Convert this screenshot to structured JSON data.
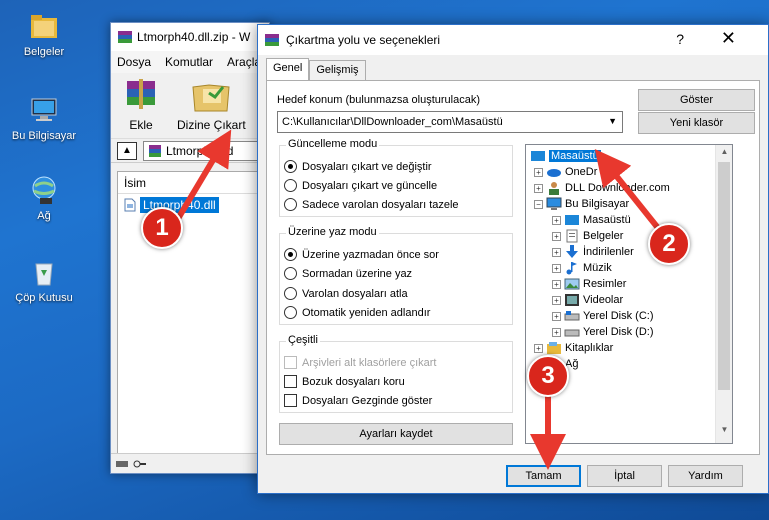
{
  "desktop": {
    "icons": [
      {
        "label": "Belgeler",
        "icon": "folder-icon"
      },
      {
        "label": "Bu Bilgisayar",
        "icon": "computer-icon"
      },
      {
        "label": "Ağ",
        "icon": "network-icon"
      },
      {
        "label": "Çöp Kutusu",
        "icon": "recycle-bin-icon"
      }
    ]
  },
  "winrar": {
    "title": "Ltmorph40.dll.zip - W",
    "menu": [
      "Dosya",
      "Komutlar",
      "Araçla"
    ],
    "toolbar": {
      "add": "Ekle",
      "extract": "Dizine Çıkart"
    },
    "path": "Ltmorph40.d",
    "column_name": "İsim",
    "file": "Ltmorph40.dll"
  },
  "dialog": {
    "title": "Çıkartma yolu ve seçenekleri",
    "help": "?",
    "close": "✕",
    "tabs": [
      "Genel",
      "Gelişmiş"
    ],
    "dest_label": "Hedef konum (bulunmazsa oluşturulacak)",
    "dest_value": "C:\\Kullanıcılar\\DllDownloader_com\\Masaüstü",
    "show_button": "Göster",
    "new_folder_button": "Yeni klasör",
    "update_mode": {
      "title": "Güncelleme modu",
      "options": [
        "Dosyaları çıkart ve değiştir",
        "Dosyaları çıkart ve güncelle",
        "Sadece varolan dosyaları tazele"
      ],
      "selected": 0
    },
    "overwrite_mode": {
      "title": "Üzerine yaz modu",
      "options": [
        "Üzerine yazmadan önce sor",
        "Sormadan üzerine yaz",
        "Varolan dosyaları atla",
        "Otomatik yeniden adlandır"
      ],
      "selected": 0
    },
    "misc": {
      "title": "Çeşitli",
      "options": [
        "Arşivleri alt klasörlere çıkart",
        "Bozuk dosyaları koru",
        "Dosyaları Gezginde göster"
      ]
    },
    "save_settings": "Ayarları kaydet",
    "tree": {
      "root": "Masaüstü",
      "items": [
        "OneDr",
        "DLL Downloader.com",
        "Bu Bilgisayar",
        "Masaüstü",
        "Belgeler",
        "İndirilenler",
        "Müzik",
        "Resimler",
        "Videolar",
        "Yerel Disk (C:)",
        "Yerel Disk (D:)",
        "Kitaplıklar",
        "Ağ"
      ]
    },
    "buttons": {
      "ok": "Tamam",
      "cancel": "İptal",
      "help": "Yardım"
    }
  },
  "annotations": {
    "badge1": "1",
    "badge2": "2",
    "badge3": "3",
    "color": "#e8382e"
  }
}
